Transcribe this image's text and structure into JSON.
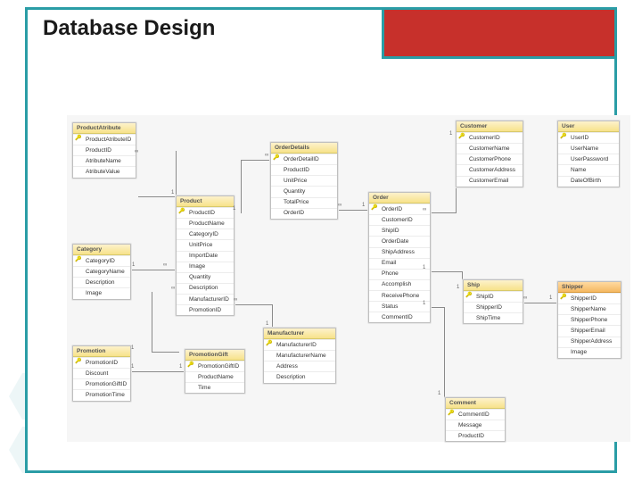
{
  "title": "Database Design",
  "tables": {
    "productattribute": {
      "name": "ProductAtribute",
      "fields": [
        "ProductAtributeID",
        "ProductID",
        "AtributeName",
        "AtributeValue"
      ],
      "pk": [
        0
      ]
    },
    "category": {
      "name": "Category",
      "fields": [
        "CategoryID",
        "CategoryName",
        "Description",
        "Image"
      ],
      "pk": [
        0
      ]
    },
    "promotion": {
      "name": "Promotion",
      "fields": [
        "PromotionID",
        "Discount",
        "PromotionGiftID",
        "PromotionTime"
      ],
      "pk": [
        0
      ]
    },
    "product": {
      "name": "Product",
      "fields": [
        "ProductID",
        "ProductName",
        "CategoryID",
        "UnitPrice",
        "ImportDate",
        "Image",
        "Quantity",
        "Description",
        "ManufacturerID",
        "PromotionID"
      ],
      "pk": [
        0
      ]
    },
    "promotiongift": {
      "name": "PromotionGift",
      "fields": [
        "PromotionGiftID",
        "ProductName",
        "Time"
      ],
      "pk": [
        0
      ]
    },
    "orderdetails": {
      "name": "OrderDetails",
      "fields": [
        "OrderDetailID",
        "ProductID",
        "UnitPrice",
        "Quantity",
        "TotalPrice",
        "OrderID"
      ],
      "pk": [
        0
      ]
    },
    "manufacturer": {
      "name": "Manufacturer",
      "fields": [
        "ManufacturerID",
        "ManufacturerName",
        "Address",
        "Description"
      ],
      "pk": [
        0
      ]
    },
    "order": {
      "name": "Order",
      "fields": [
        "OrderID",
        "CustomerID",
        "ShipID",
        "OrderDate",
        "ShipAddress",
        "Email",
        "Phone",
        "Accomplish",
        "ReceivePhone",
        "Status",
        "CommentID"
      ],
      "pk": [
        0
      ]
    },
    "customer": {
      "name": "Customer",
      "fields": [
        "CustomerID",
        "CustomerName",
        "CustomerPhone",
        "CustomerAddress",
        "CustomerEmail"
      ],
      "pk": [
        0
      ]
    },
    "ship": {
      "name": "Ship",
      "fields": [
        "ShipID",
        "ShipperID",
        "ShipTime"
      ],
      "pk": [
        0
      ]
    },
    "comment": {
      "name": "Comment",
      "fields": [
        "CommentID",
        "Message",
        "ProductID"
      ],
      "pk": [
        0
      ]
    },
    "user": {
      "name": "User",
      "fields": [
        "UserID",
        "UserName",
        "UserPassword",
        "Name",
        "DateOfBirth"
      ],
      "pk": [
        0
      ]
    },
    "shipper": {
      "name": "Shipper",
      "fields": [
        "ShipperID",
        "ShipperName",
        "ShipperPhone",
        "ShipperEmail",
        "ShipperAddress",
        "Image"
      ],
      "pk": [
        0
      ]
    }
  },
  "cardinality": {
    "one": "1",
    "many": "∞"
  }
}
